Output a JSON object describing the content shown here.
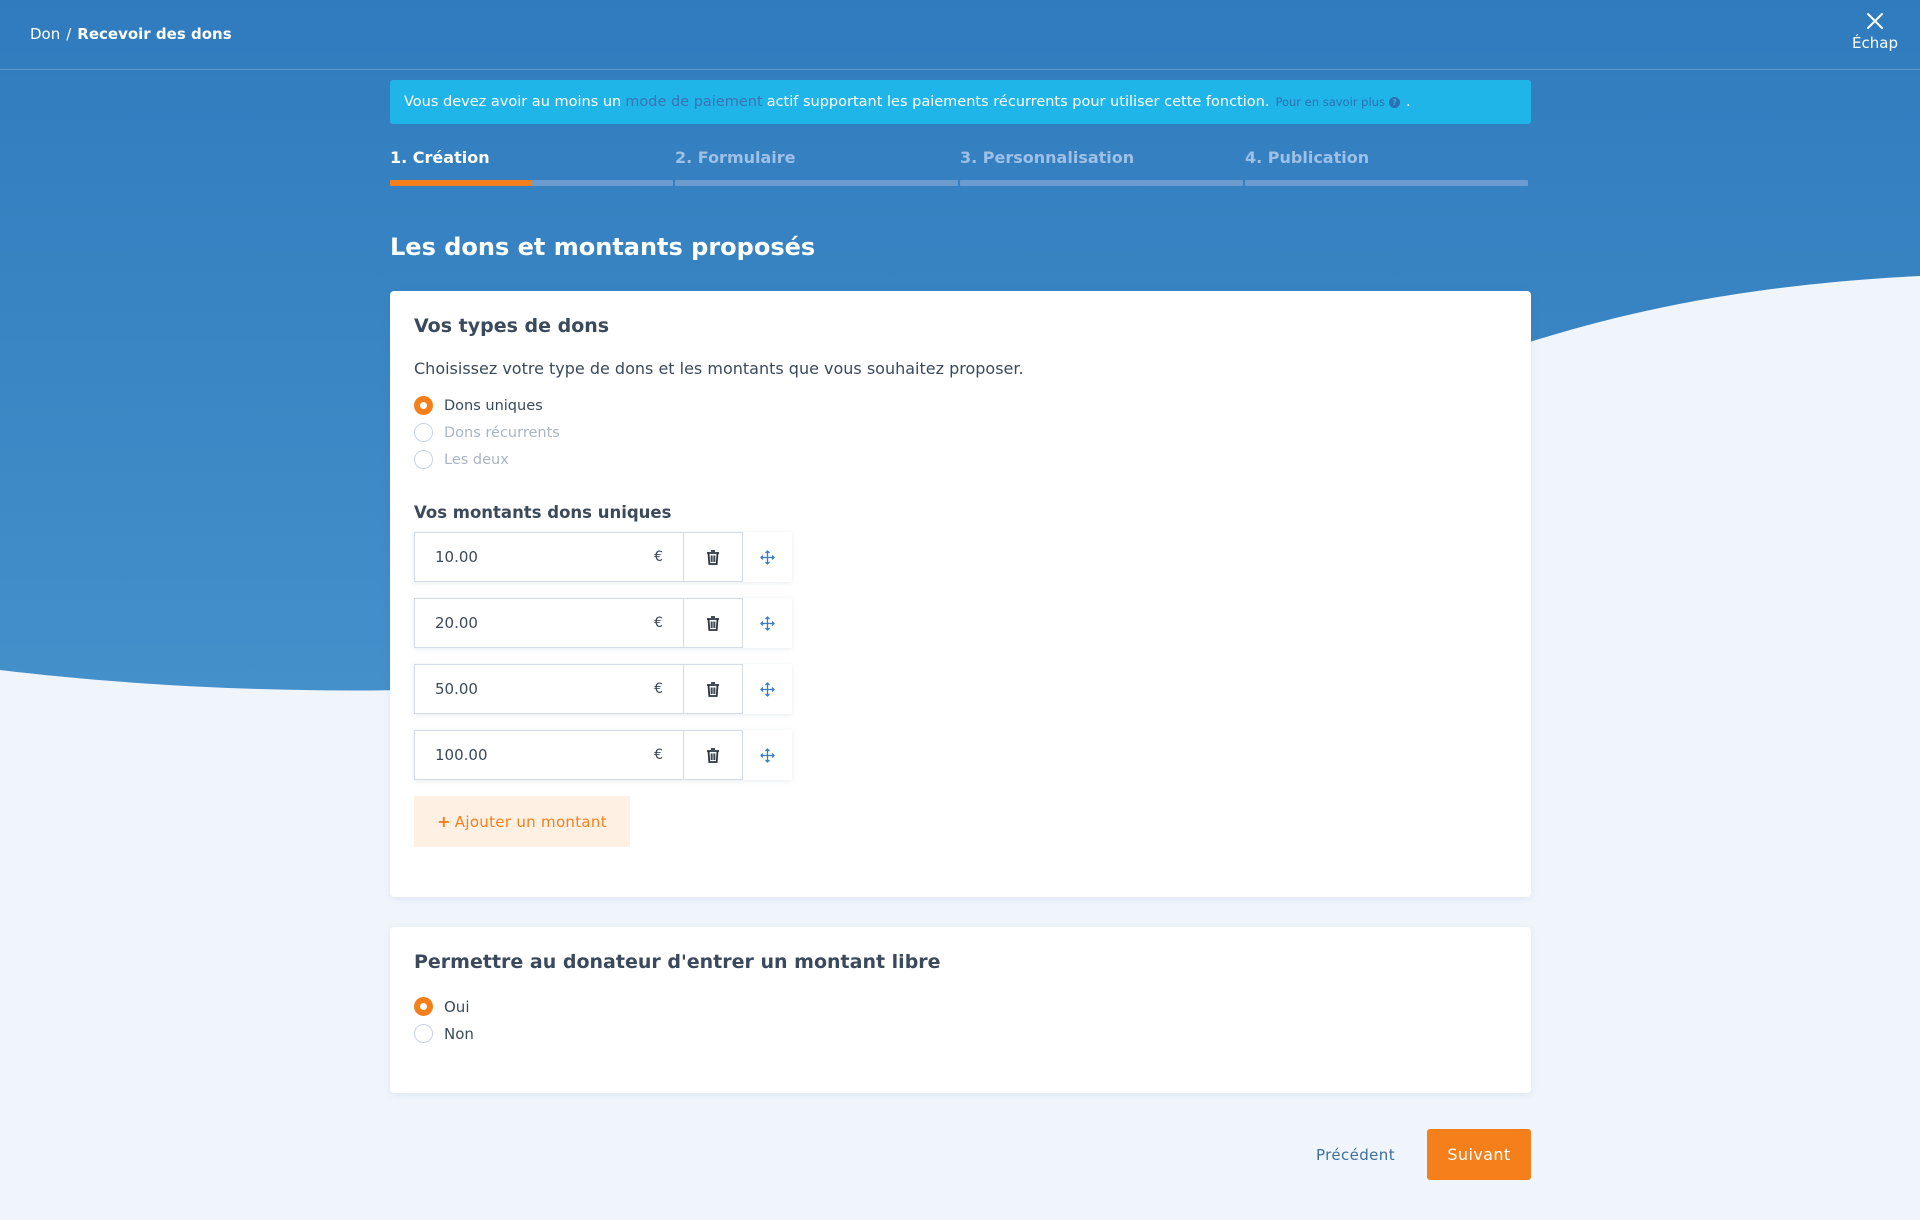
{
  "colors": {
    "header_top": "#2f7bbd",
    "header_bottom": "#3f8ec9",
    "accent": "#f57f1a",
    "info": "#1fb5e8",
    "page_bg": "#f0f5fc"
  },
  "breadcrumb": {
    "root": "Don",
    "separator": "/",
    "current": "Recevoir des dons"
  },
  "escape": {
    "label": "Échap",
    "icon": "close-icon"
  },
  "alert": {
    "text_before": "Vous devez avoir au moins un",
    "link_text": "mode de paiement",
    "text_after": "actif supportant les paiements récurrents pour utiliser cette fonction.",
    "more_text": "Pour en savoir plus",
    "more_icon": "question-circle-icon",
    "end": "."
  },
  "steps": [
    {
      "label": "1. Création",
      "active": true,
      "progress": 0.5
    },
    {
      "label": "2. Formulaire",
      "active": false,
      "progress": 0
    },
    {
      "label": "3. Personnalisation",
      "active": false,
      "progress": 0
    },
    {
      "label": "4. Publication",
      "active": false,
      "progress": 0
    }
  ],
  "section_title": "Les dons et montants proposés",
  "donation_types": {
    "title": "Vos types de dons",
    "description": "Choisissez votre type de dons et les montants que vous souhaitez proposer.",
    "options": [
      {
        "label": "Dons uniques",
        "checked": true
      },
      {
        "label": "Dons récurrents",
        "checked": false
      },
      {
        "label": "Les deux",
        "checked": false
      }
    ],
    "amounts_title": "Vos montants dons uniques",
    "currency": "€",
    "amounts": [
      "10.00",
      "20.00",
      "50.00",
      "100.00"
    ],
    "delete_icon": "trash-icon",
    "move_icon": "move-arrows-icon",
    "add_plus": "+",
    "add_label": "Ajouter un montant"
  },
  "free_amount": {
    "title": "Permettre au donateur d'entrer un montant libre",
    "options": [
      {
        "label": "Oui",
        "checked": true
      },
      {
        "label": "Non",
        "checked": false
      }
    ]
  },
  "actions": {
    "previous": "Précédent",
    "next": "Suivant"
  }
}
